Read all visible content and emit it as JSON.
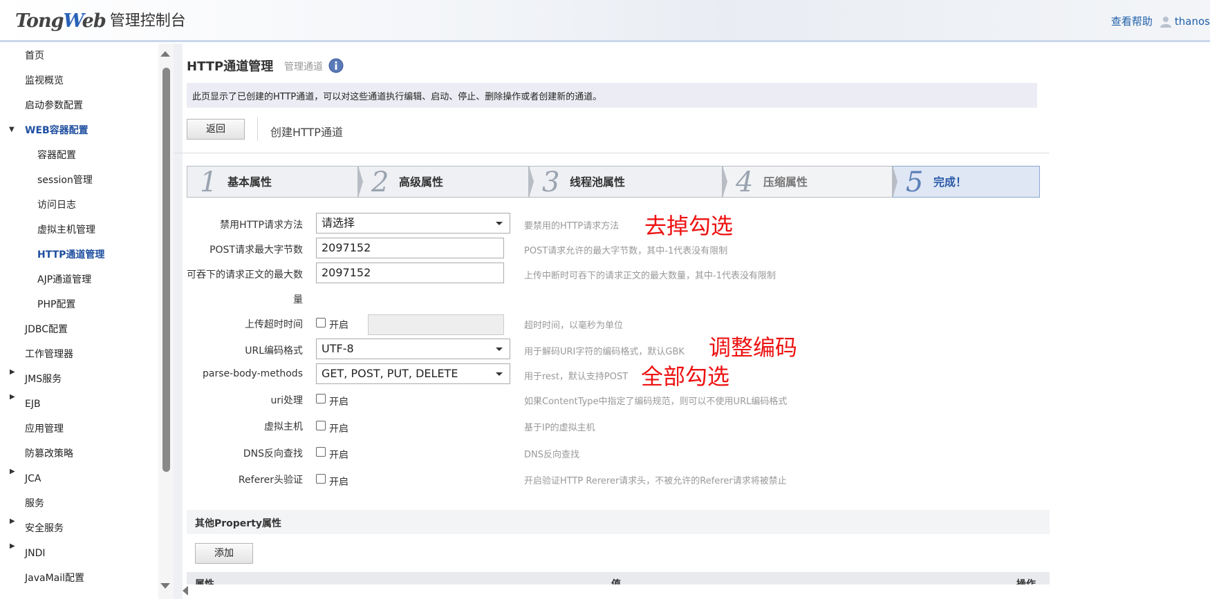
{
  "header": {
    "logo_text": "管理控制台",
    "help_link": "查看帮助",
    "user_name": "thanos"
  },
  "sidebar": {
    "items": [
      {
        "label": "首页",
        "level": 1
      },
      {
        "label": "监视概览",
        "level": 1
      },
      {
        "label": "启动参数配置",
        "level": 1
      },
      {
        "label": "WEB容器配置",
        "level": 1,
        "expanded": true,
        "active_group": true
      },
      {
        "label": "容器配置",
        "level": 2
      },
      {
        "label": "session管理",
        "level": 2
      },
      {
        "label": "访问日志",
        "level": 2
      },
      {
        "label": "虚拟主机管理",
        "level": 2
      },
      {
        "label": "HTTP通道管理",
        "level": 2,
        "selected": true
      },
      {
        "label": "AJP通道管理",
        "level": 2
      },
      {
        "label": "PHP配置",
        "level": 2
      },
      {
        "label": "JDBC配置",
        "level": 1
      },
      {
        "label": "工作管理器",
        "level": 1
      },
      {
        "label": "JMS服务",
        "level": 1,
        "collapsed": true
      },
      {
        "label": "EJB",
        "level": 1,
        "collapsed": true
      },
      {
        "label": "应用管理",
        "level": 1
      },
      {
        "label": "防篡改策略",
        "level": 1
      },
      {
        "label": "JCA",
        "level": 1,
        "collapsed": true
      },
      {
        "label": "服务",
        "level": 1
      },
      {
        "label": "安全服务",
        "level": 1,
        "collapsed": true
      },
      {
        "label": "JNDI",
        "level": 1,
        "collapsed": true
      },
      {
        "label": "JavaMail配置",
        "level": 1
      }
    ]
  },
  "page": {
    "title": "HTTP通道管理",
    "subtitle": "管理通道",
    "description": "此页显示了已创建的HTTP通道，可以对这些通道执行编辑、启动、停止、删除操作或者创建新的通道。",
    "back_button": "返回",
    "create_label": "创建HTTP通道"
  },
  "wizard": {
    "steps": [
      {
        "num": "1",
        "label": "基本属性",
        "state": "done"
      },
      {
        "num": "2",
        "label": "高级属性",
        "state": "done"
      },
      {
        "num": "3",
        "label": "线程池属性",
        "state": "done"
      },
      {
        "num": "4",
        "label": "压缩属性",
        "state": "future"
      },
      {
        "num": "5",
        "label": "完成！",
        "state": "current"
      }
    ]
  },
  "form": {
    "disabled_methods": {
      "label": "禁用HTTP请求方法",
      "value": "请选择",
      "help": "要禁用的HTTP请求方法"
    },
    "post_max": {
      "label": "POST请求最大字节数",
      "value": "2097152",
      "help": "POST请求允许的最大字节数，其中-1代表没有限制"
    },
    "swallow_max": {
      "label_line1": "可吞下的请求正文的最大数",
      "label_line2": "量",
      "value": "2097152",
      "help": "上传中断时可吞下的请求正文的最大数量，其中-1代表没有限制"
    },
    "upload_timeout": {
      "label": "上传超时时间",
      "checkbox_label": "开启",
      "checked": false,
      "help": "超时时间，以毫秒为单位"
    },
    "uri_encoding": {
      "label": "URL编码格式",
      "value": "UTF-8",
      "help": "用于解码URI字符的编码格式，默认GBK"
    },
    "parse_body": {
      "label": "parse-body-methods",
      "value": "GET, POST, PUT, DELETE",
      "help": "用于rest，默认支持POST"
    },
    "uri_handling": {
      "label": "uri处理",
      "checkbox_label": "开启",
      "checked": false,
      "help": "如果ContentType中指定了编码规范，则可以不使用URL编码格式"
    },
    "virtual_host": {
      "label": "虚拟主机",
      "checkbox_label": "开启",
      "checked": false,
      "help": "基于IP的虚拟主机"
    },
    "dns_lookup": {
      "label": "DNS反向查找",
      "checkbox_label": "开启",
      "checked": false,
      "help": "DNS反向查找"
    },
    "referer_check": {
      "label": "Referer头验证",
      "checkbox_label": "开启",
      "checked": false,
      "help": "开启验证HTTP Rererer请求头，不被允许的Referer请求将被禁止"
    }
  },
  "annotations": {
    "remove_check": "去掉勾选",
    "adjust_encoding": "调整编码",
    "select_all": "全部勾选",
    "color": "#ee1111"
  },
  "properties": {
    "title": "其他Property属性",
    "add_button": "添加",
    "columns": [
      "属性",
      "值",
      "操作"
    ]
  },
  "colors": {
    "accent": "#1f4fa0",
    "link": "#1f5fa8",
    "desc_bg": "#ecedf4"
  }
}
